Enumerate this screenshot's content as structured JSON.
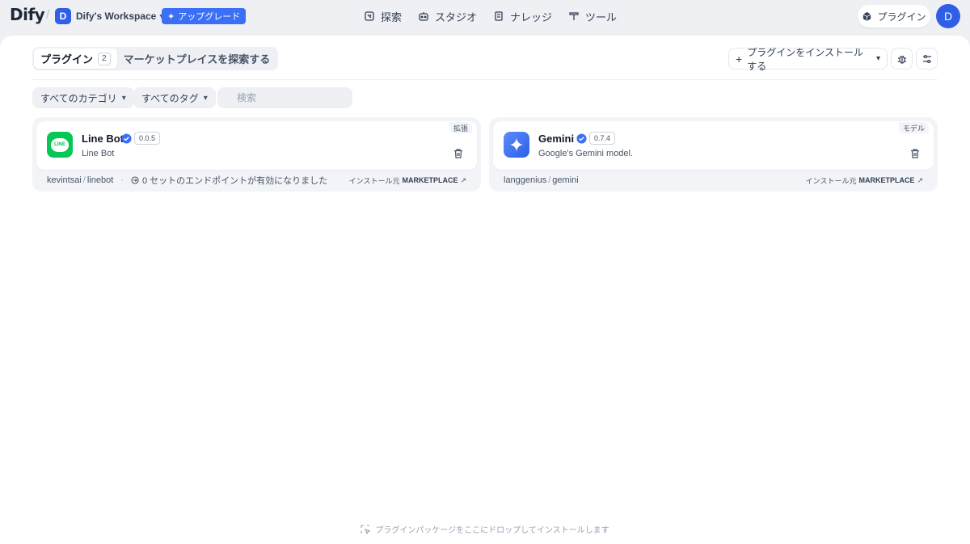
{
  "header": {
    "logo": "Dify",
    "workspace": {
      "initial": "D",
      "name": "Dify's Workspace"
    },
    "upgrade_label": "アップグレード",
    "nav": [
      {
        "label": "探索",
        "icon": "explore-icon"
      },
      {
        "label": "スタジオ",
        "icon": "studio-robot-icon"
      },
      {
        "label": "ナレッジ",
        "icon": "knowledge-book-icon"
      },
      {
        "label": "ツール",
        "icon": "tools-hammer-icon"
      }
    ],
    "plugins_label": "プラグイン",
    "user_initial": "D"
  },
  "toolbar": {
    "tabs": [
      {
        "label": "プラグイン",
        "count": "2",
        "active": true
      },
      {
        "label": "マーケットプレイスを探索する",
        "active": false
      }
    ],
    "install_label": "プラグインをインストールする"
  },
  "filters": {
    "category": "すべてのカテゴリ",
    "tags": "すべてのタグ",
    "search_placeholder": "検索"
  },
  "plugins": [
    {
      "name": "Line Bot",
      "version": "0.0.5",
      "description": "Line Bot",
      "badge": "拡張",
      "org": "kevintsai",
      "slug": "linebot",
      "endpoints": "0 セットのエンドポイントが有効になりました",
      "source_prefix": "インストール元",
      "source": "MARKETPLACE",
      "icon_text": "LINE",
      "icon_color": "#06c755"
    },
    {
      "name": "Gemini",
      "version": "0.7.4",
      "description": "Google's Gemini model.",
      "badge": "モデル",
      "org": "langgenius",
      "slug": "gemini",
      "source_prefix": "インストール元",
      "source": "MARKETPLACE",
      "icon_color": "#3b6ff5"
    }
  ],
  "drop_hint": "プラグインパッケージをここにドロップしてインストールします",
  "colors": {
    "accent": "#2e5fe6",
    "verified": "#3b6ff5"
  }
}
